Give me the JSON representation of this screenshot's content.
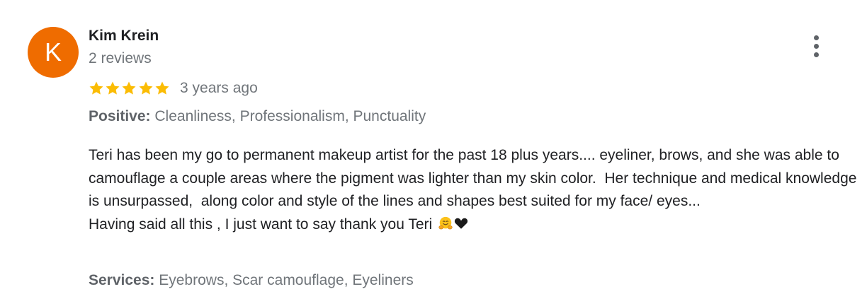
{
  "review": {
    "author": {
      "initial": "K",
      "name": "Kim Krein",
      "review_count": "2 reviews",
      "avatar_color": "#ef6c00"
    },
    "rating": 5,
    "rating_max": 5,
    "star_color": "#fbbc04",
    "timestamp": "3 years ago",
    "positive": {
      "label": "Positive:",
      "value": "Cleanliness, Professionalism, Punctuality"
    },
    "text": {
      "paragraph_1": "Teri has been my go to permanent makeup artist for the past 18 plus years.... eyeliner, brows, and she was able to camouflage a couple areas where the pigment was lighter than my skin color.  Her technique and medical knowledge is unsurpassed,  along color and style of the lines and shapes best suited for my face/ eyes...",
      "paragraph_2": "Having said all this , I just want to say thank you Teri",
      "trailing_emoji": [
        "hugging-face-icon",
        "black-heart-icon"
      ]
    },
    "services": {
      "label": "Services:",
      "value": "Eyebrows, Scar camouflage, Eyeliners"
    },
    "menu_icon": "more-vert-icon"
  }
}
